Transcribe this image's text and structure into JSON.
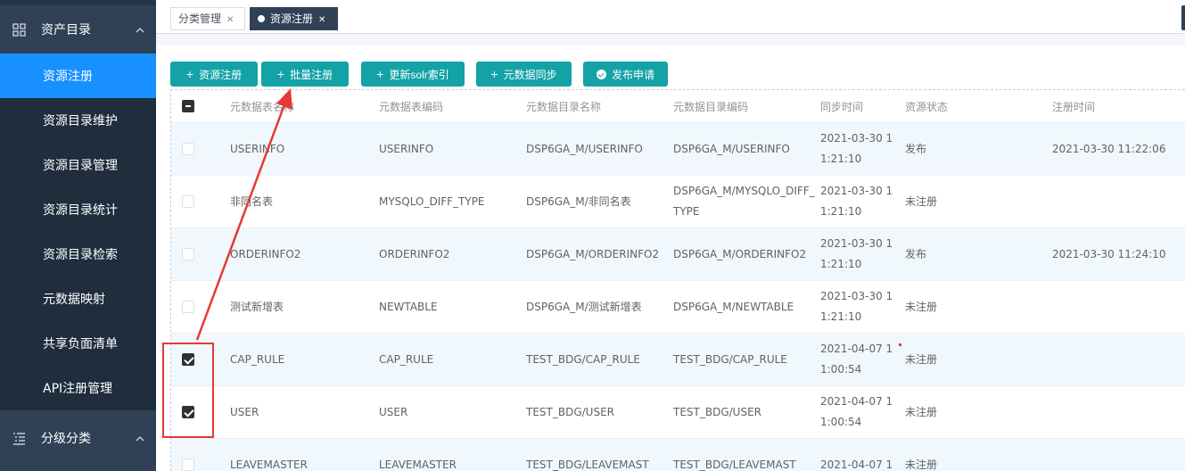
{
  "sidebar": {
    "groups": [
      {
        "label": "资产目录",
        "icon": "grid-icon"
      },
      {
        "label": "分级分类",
        "icon": "list-icon"
      }
    ],
    "items": [
      {
        "label": "资源注册",
        "active": true
      },
      {
        "label": "资源目录维护"
      },
      {
        "label": "资源目录管理"
      },
      {
        "label": "资源目录统计"
      },
      {
        "label": "资源目录检索"
      },
      {
        "label": "元数据映射"
      },
      {
        "label": "共享负面清单"
      },
      {
        "label": "API注册管理"
      }
    ]
  },
  "tabs": [
    {
      "label": "分类管理",
      "active": false
    },
    {
      "label": "资源注册",
      "active": true
    }
  ],
  "toolbar": {
    "buttons": [
      {
        "label": "资源注册",
        "icon": "plus-icon"
      },
      {
        "label": "批量注册",
        "icon": "plus-icon"
      },
      {
        "label": "更新solr索引",
        "icon": "plus-icon"
      },
      {
        "label": "元数据同步",
        "icon": "plus-icon"
      },
      {
        "label": "发布申请",
        "icon": "check-circle-icon"
      }
    ]
  },
  "table": {
    "columns": [
      "元数据表名称",
      "元数据表编码",
      "元数据目录名称",
      "元数据目录编码",
      "同步时间",
      "资源状态",
      "注册时间"
    ],
    "rows": [
      {
        "checked": false,
        "cells": [
          "USERINFO",
          "USERINFO",
          "DSP6GA_M/USERINFO",
          "DSP6GA_M/USERINFO",
          "2021-03-30 11:21:10",
          "发布",
          "2021-03-30 11:22:06"
        ]
      },
      {
        "checked": false,
        "cells": [
          "非同名表",
          "MYSQLO_DIFF_TYPE",
          "DSP6GA_M/非同名表",
          "DSP6GA_M/MYSQLO_DIFF_TYPE",
          "2021-03-30 11:21:10",
          "未注册",
          ""
        ]
      },
      {
        "checked": false,
        "cells": [
          "ORDERINFO2",
          "ORDERINFO2",
          "DSP6GA_M/ORDERINFO2",
          "DSP6GA_M/ORDERINFO2",
          "2021-03-30 11:21:10",
          "发布",
          "2021-03-30 11:24:10"
        ]
      },
      {
        "checked": false,
        "cells": [
          "测试新增表",
          "NEWTABLE",
          "DSP6GA_M/测试新增表",
          "DSP6GA_M/NEWTABLE",
          "2021-03-30 11:21:10",
          "未注册",
          ""
        ]
      },
      {
        "checked": true,
        "cells": [
          "CAP_RULE",
          "CAP_RULE",
          "TEST_BDG/CAP_RULE",
          "TEST_BDG/CAP_RULE",
          "2021-04-07 11:00:54",
          "未注册",
          ""
        ]
      },
      {
        "checked": true,
        "cells": [
          "USER",
          "USER",
          "TEST_BDG/USER",
          "TEST_BDG/USER",
          "2021-04-07 11:00:54",
          "未注册",
          ""
        ]
      },
      {
        "checked": false,
        "cells": [
          "LEAVEMASTER",
          "LEAVEMASTER",
          "TEST_BDG/LEAVEMAST",
          "TEST_BDG/LEAVEMAST",
          "2021-04-07 1",
          "未注册",
          ""
        ]
      }
    ]
  },
  "colors": {
    "sidebar_bg": "#304156",
    "active_item": "#1890ff",
    "button": "#13a2a6",
    "annotation": "#e53935"
  }
}
